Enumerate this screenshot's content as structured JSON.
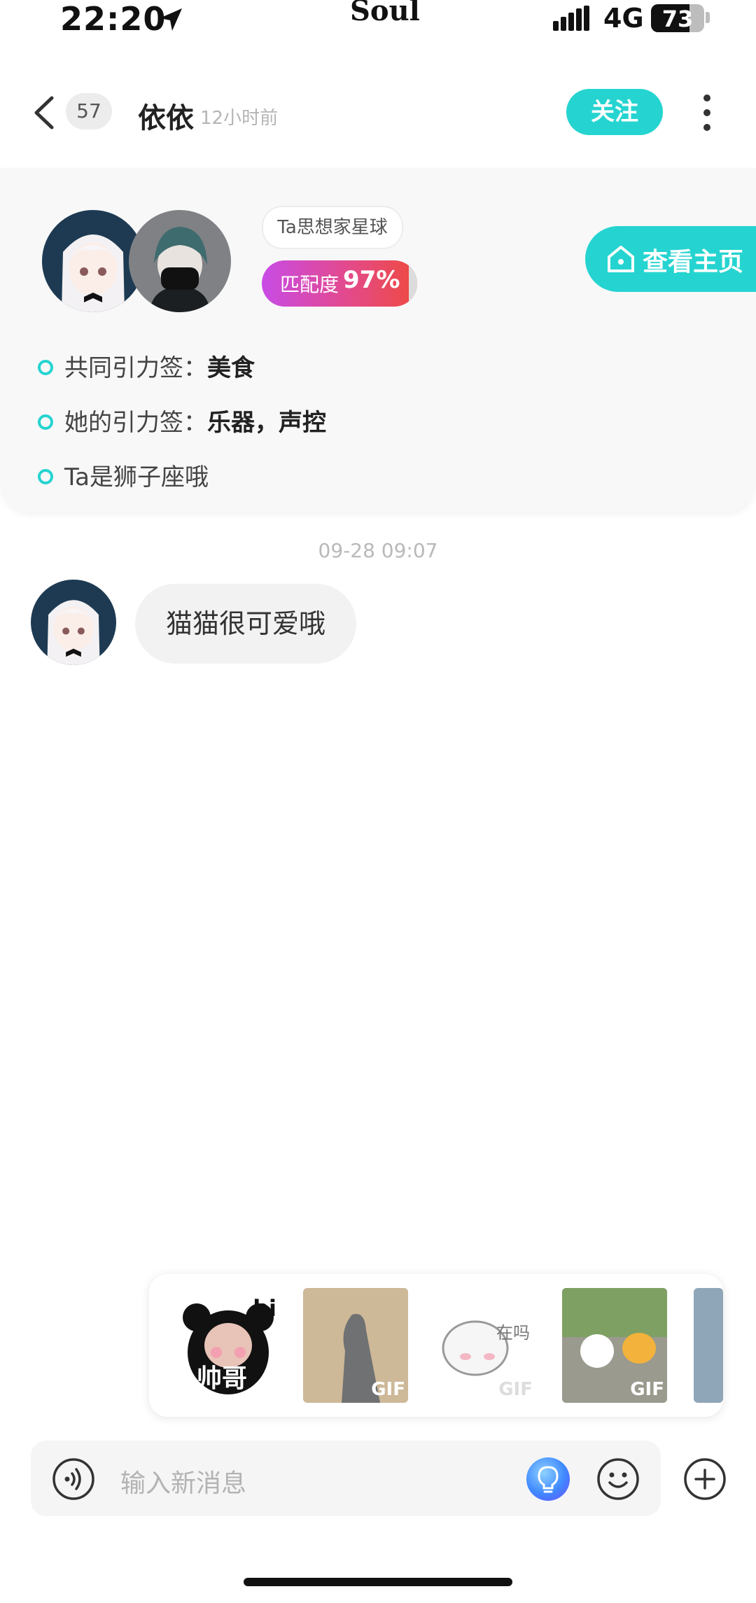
{
  "status_bar": {
    "time": "22:20",
    "app_name": "Soul",
    "network": "4G",
    "battery": "73",
    "battery_level": 0.73
  },
  "header": {
    "unread_count": "57",
    "name": "依依",
    "last_seen": "12小时前",
    "follow_label": "关注"
  },
  "profile": {
    "planet": "Ta思想家星球",
    "match_label": "匹配度",
    "match_value": "97%",
    "match_level": 0.97,
    "homepage_label": "查看主页",
    "tags": [
      {
        "label": "共同引力签：",
        "value": "美食"
      },
      {
        "label": "她的引力签：",
        "value": "乐器，声控"
      },
      {
        "label": "Ta是狮子座哦",
        "value": ""
      }
    ]
  },
  "chat": {
    "timestamp": "09-28 09:07",
    "messages": [
      {
        "text": "猫猫很可爱哦"
      }
    ]
  },
  "stickers": [
    {
      "caption": "帅哥",
      "overlay": "hi"
    },
    {
      "caption": "",
      "overlay": "GIF"
    },
    {
      "caption": "",
      "overlay": "在吗",
      "badge": "GIF"
    },
    {
      "caption": "",
      "overlay": "GIF"
    },
    {
      "caption": "",
      "overlay": ""
    }
  ],
  "input": {
    "placeholder": "输入新消息"
  },
  "colors": {
    "accent": "#25d4d0",
    "match_gradient_start": "#c84be6",
    "match_gradient_end": "#ef4a3f"
  }
}
